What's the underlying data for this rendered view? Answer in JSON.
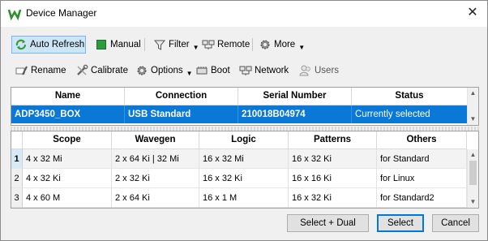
{
  "window": {
    "title": "Device Manager",
    "close_glyph": "✕"
  },
  "toolbar1": {
    "auto_refresh": "Auto Refresh",
    "manual": "Manual",
    "filter": "Filter",
    "remote": "Remote",
    "more": "More"
  },
  "toolbar2": {
    "rename": "Rename",
    "calibrate": "Calibrate",
    "options": "Options",
    "boot": "Boot",
    "network": "Network",
    "users": "Users"
  },
  "device_table": {
    "headers": [
      "Name",
      "Connection",
      "Serial Number",
      "Status"
    ],
    "rows": [
      {
        "name": "ADP3450_BOX",
        "connection": "USB Standard",
        "serial": "210018B04974",
        "status": "Currently selected"
      }
    ]
  },
  "config_table": {
    "headers": [
      "Scope",
      "Wavegen",
      "Logic",
      "Patterns",
      "Others"
    ],
    "rows": [
      {
        "num": "1",
        "scope": "4 x 32 Mi",
        "wavegen": "2 x 64 Ki | 32 Mi",
        "logic": "16 x 32 Mi",
        "patterns": "16 x 32 Ki",
        "others": "for Standard"
      },
      {
        "num": "2",
        "scope": "4 x 32 Ki",
        "wavegen": "2 x 32 Ki",
        "logic": "16 x 32 Ki",
        "patterns": "16 x 16 Ki",
        "others": "for Linux"
      },
      {
        "num": "3",
        "scope": "4 x 60 M",
        "wavegen": "2 x 64 Ki",
        "logic": "16 x 1 M",
        "patterns": "16 x 32 Ki",
        "others": "for Standard2"
      }
    ]
  },
  "buttons": {
    "select_dual": "Select + Dual",
    "select": "Select",
    "cancel": "Cancel"
  },
  "colors": {
    "selection": "#0a78d7",
    "accent_green": "#3a9a3a"
  }
}
